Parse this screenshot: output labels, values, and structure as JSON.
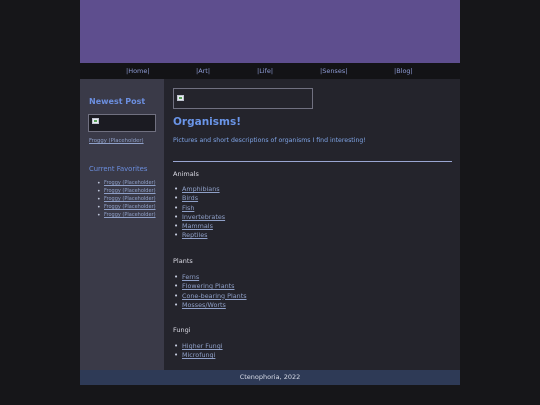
{
  "nav": {
    "items": [
      "|Home|",
      "|Art|",
      "|Life|",
      "|Senses|",
      "|Blog|"
    ]
  },
  "sidebar": {
    "newest_title": "Newest Post",
    "newest_link": "Froggy (Placeholder)",
    "favorites_title": "Current Favorites",
    "favorites": [
      "Froggy (Placeholder)",
      "Froggy (Placeholder)",
      "Froggy (Placeholder)",
      "Froggy (Placeholder)",
      "Froggy (Placeholder)"
    ]
  },
  "main": {
    "title": "Organisms!",
    "intro": "Pictures and short descriptions of organisms I find interesting!",
    "sections": [
      {
        "heading": "Animals",
        "items": [
          "Amphibians",
          "Birds",
          "Fish",
          "Invertebrates",
          "Mammals",
          "Reptiles"
        ]
      },
      {
        "heading": "Plants",
        "items": [
          "Ferns",
          "Flowering Plants",
          "Cone-bearing Plants",
          "Mosses/Worts"
        ]
      },
      {
        "heading": "Fungi",
        "items": [
          "Higher Fungi",
          "Microfungi"
        ]
      }
    ]
  },
  "footer": {
    "text": "Ctenophoria, 2022"
  },
  "colors": {
    "banner": "#5e4e8e",
    "accent": "#6a95e8",
    "link": "#8fa0c8",
    "footer": "#2e3a56"
  }
}
